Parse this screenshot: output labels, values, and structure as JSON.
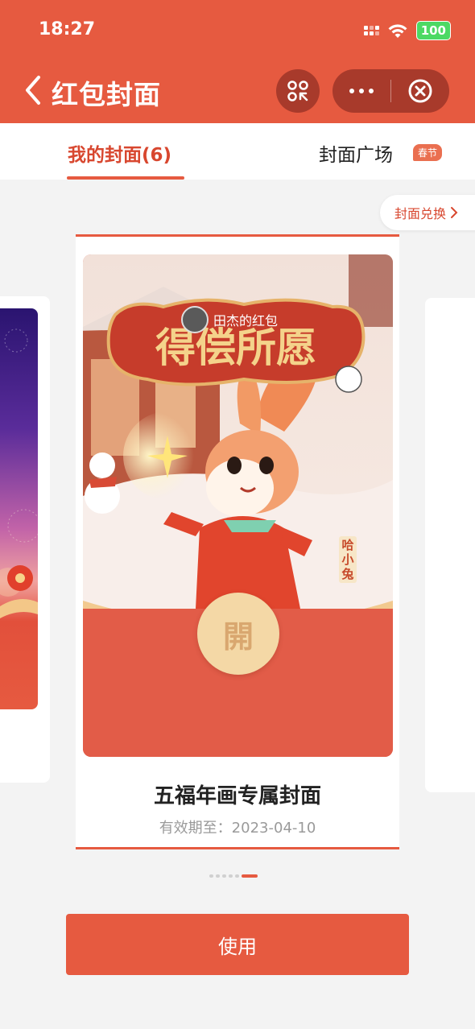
{
  "status_bar": {
    "time": "18:27",
    "battery": "100"
  },
  "header": {
    "title": "红包封面",
    "back_icon": "chevron-left-icon",
    "scan_icon": "scan-icon",
    "more_icon": "more-icon",
    "close_icon": "close-circle-icon"
  },
  "tabs": {
    "mine_label": "我的封面(6)",
    "square_label": "封面广场",
    "square_badge": "春节"
  },
  "redeem": {
    "label": "封面兑换",
    "icon": "chevron-right-icon"
  },
  "cover": {
    "sender_name": "田杰的红包",
    "banner_text": "得偿所愿",
    "character_name": "哈小兔",
    "open_label": "開"
  },
  "card": {
    "title": "五福年画专属封面",
    "validity": "有效期至：2023-04-10"
  },
  "pager": {
    "count": 6,
    "active_index": 5
  },
  "footer": {
    "use_label": "使用"
  },
  "colors": {
    "primary": "#e65a40",
    "tab_active": "#d8472f",
    "badge": "#ea6f50"
  }
}
